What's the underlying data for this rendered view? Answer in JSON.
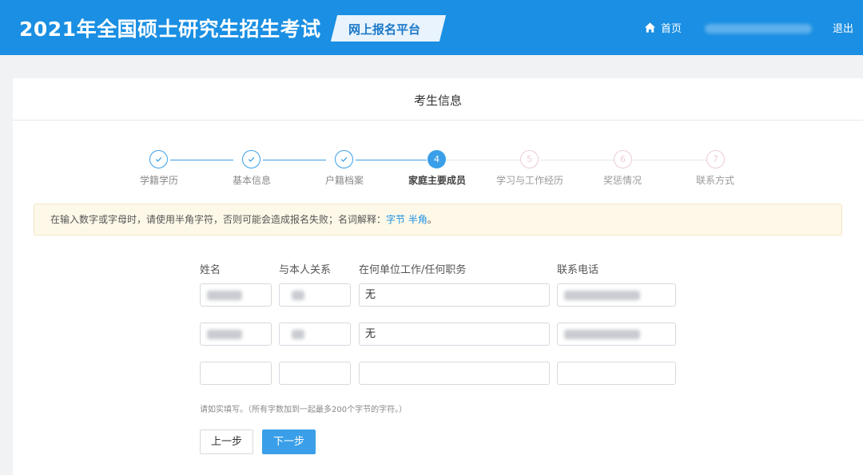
{
  "header": {
    "title": "2021年全国硕士研究生招生考试",
    "platform": "网上报名平台",
    "home_label": "首页",
    "logout_label": "退出"
  },
  "page": {
    "title": "考生信息"
  },
  "steps": [
    {
      "number": "1",
      "label": "学籍学历",
      "status": "done"
    },
    {
      "number": "2",
      "label": "基本信息",
      "status": "done"
    },
    {
      "number": "3",
      "label": "户籍档案",
      "status": "done"
    },
    {
      "number": "4",
      "label": "家庭主要成员",
      "status": "current"
    },
    {
      "number": "5",
      "label": "学习与工作经历",
      "status": "todo"
    },
    {
      "number": "6",
      "label": "奖惩情况",
      "status": "todo"
    },
    {
      "number": "7",
      "label": "联系方式",
      "status": "todo"
    }
  ],
  "notice": {
    "text": "在输入数字或字母时，请使用半角字符，否则可能会造成报名失败；名词解释：",
    "link_byte": "字节",
    "link_halfwidth": "半角",
    "end": "。"
  },
  "family_form": {
    "columns": [
      "姓名",
      "与本人关系",
      "在何单位工作/任何职务",
      "联系电话"
    ],
    "rows": [
      {
        "name": "",
        "relation": "",
        "work": "无",
        "phone": ""
      },
      {
        "name": "",
        "relation": "",
        "work": "无",
        "phone": ""
      },
      {
        "name": "",
        "relation": "",
        "work": "",
        "phone": ""
      }
    ],
    "hint": "请如实填写。（所有字数加到一起最多200个字节的字符。）"
  },
  "buttons": {
    "prev": "上一步",
    "next": "下一步"
  },
  "colors": {
    "header_bg": "#1a8fe3",
    "accent": "#3a9fe8",
    "notice_bg": "#fdf8e8"
  },
  "icons": {
    "home": "home-icon",
    "done_step": "check-icon"
  }
}
